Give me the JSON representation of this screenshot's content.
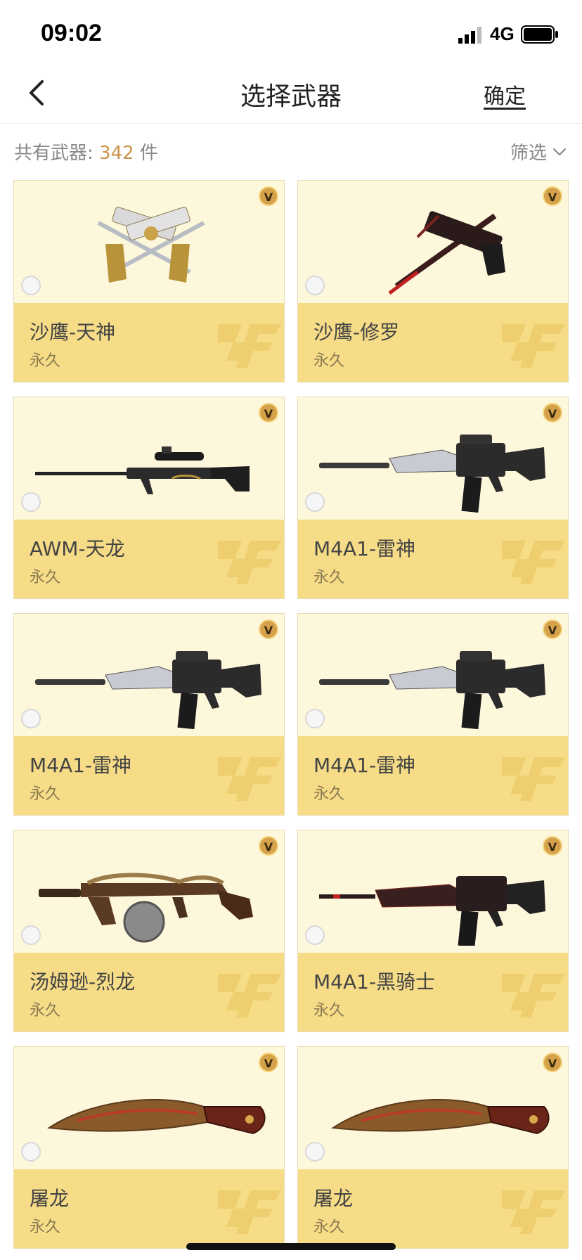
{
  "status": {
    "time": "09:02",
    "network": "4G"
  },
  "nav": {
    "title": "选择武器",
    "confirm_label": "确定"
  },
  "summary": {
    "prefix": "共有武器: ",
    "count": "342",
    "suffix": " 件",
    "filter_label": "筛选"
  },
  "colors": {
    "card_top": "#fdf7dc",
    "card_bottom": "#f6dc87",
    "accent": "#c9934a"
  },
  "items": [
    {
      "name": "沙鹰-天神",
      "duration": "永久",
      "badge": "V",
      "art": "dual-pistols-gold"
    },
    {
      "name": "沙鹰-修罗",
      "duration": "永久",
      "badge": "V",
      "art": "pistol-knife-red"
    },
    {
      "name": "AWM-天龙",
      "duration": "永久",
      "badge": "V",
      "art": "sniper-rifle"
    },
    {
      "name": "M4A1-雷神",
      "duration": "永久",
      "badge": "V",
      "art": "assault-rifle-silver"
    },
    {
      "name": "M4A1-雷神",
      "duration": "永久",
      "badge": "V",
      "art": "assault-rifle-silver"
    },
    {
      "name": "M4A1-雷神",
      "duration": "永久",
      "badge": "V",
      "art": "assault-rifle-silver"
    },
    {
      "name": "汤姆逊-烈龙",
      "duration": "永久",
      "badge": "V",
      "art": "thompson-dragon"
    },
    {
      "name": "M4A1-黑骑士",
      "duration": "永久",
      "badge": "V",
      "art": "assault-rifle-red"
    },
    {
      "name": "屠龙",
      "duration": "永久",
      "badge": "V",
      "art": "kukri-knife"
    },
    {
      "name": "屠龙",
      "duration": "永久",
      "badge": "V",
      "art": "kukri-knife"
    }
  ]
}
